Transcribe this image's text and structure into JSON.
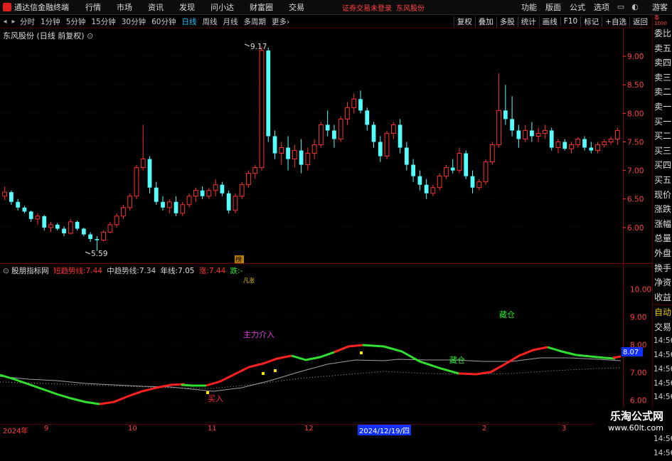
{
  "menubar": {
    "app_title": "通达信金融终端",
    "items": [
      "行情",
      "市场",
      "资讯",
      "发现",
      "问小达",
      "财富圈",
      "交易"
    ],
    "alert": "证券交易未登录",
    "stock": "东风股份",
    "right_items": [
      "功能",
      "版面",
      "公式",
      "选项"
    ],
    "user": "游客"
  },
  "toolbar": {
    "periods": [
      "分时",
      "1分钟",
      "5分钟",
      "15分钟",
      "30分钟",
      "60分钟",
      "日线",
      "周线",
      "月线",
      "多周期",
      "更多"
    ],
    "active_period": "日线",
    "right_buttons": [
      "复权",
      "叠加",
      "多股",
      "统计",
      "画线",
      "F10",
      "标记",
      "+自选",
      "返回"
    ]
  },
  "stock_title": "东风股份 (日线 前复权)",
  "main_chart": {
    "price_max_label": "9.17",
    "price_min_label": "5.59",
    "badge": "榜",
    "y_ticks": [
      "9.00",
      "8.50",
      "8.00",
      "7.50",
      "7.00",
      "6.50",
      "6.00"
    ]
  },
  "indicator": {
    "name": "股朋指标网",
    "short_label": "短趋势线:",
    "short_value": "7.44",
    "mid_label": "中趋势线:",
    "mid_value": "7.34",
    "year_label": "年线:",
    "year_value": "7.05",
    "rise_label": "涨:",
    "rise_value": "7.44",
    "fall_label": "跌:",
    "fall_value": "-",
    "top_mark": "凡涨",
    "annotations": {
      "main_in": "主力介入",
      "hide1": "藏仓",
      "hide2": "藏仓",
      "buy": "买入"
    },
    "y_ticks": [
      "10.00",
      "9.00",
      "8.00",
      "7.00",
      "6.00"
    ],
    "current_value": "8.07"
  },
  "side_panel": {
    "top_labels": [
      "委",
      "1000"
    ],
    "items": [
      "委比",
      "卖五",
      "卖四",
      "卖三",
      "卖二",
      "卖一",
      "买一",
      "买二",
      "买三",
      "买四",
      "买五",
      "现价",
      "涨跌",
      "涨幅",
      "总量",
      "外盘",
      "换手",
      "净资",
      "收益"
    ],
    "items2": [
      "自动",
      "交易"
    ],
    "times": [
      "14:56",
      "14:56",
      "14:56",
      "14:56",
      "14:56",
      "14:56",
      "14:56",
      "14:56",
      "14:56"
    ]
  },
  "x_axis": [
    "2024年",
    "9",
    "10",
    "11",
    "12",
    "2024/12/19/四",
    "2",
    "3"
  ],
  "watermark": {
    "line1": "乐淘公式网",
    "line2": "www.60lt.com"
  },
  "colors": {
    "up": "#ff3030",
    "down": "#54ffff",
    "bg": "#000000",
    "accent_red": "#ff4040",
    "line_green": "#30e030",
    "line_gray": "#a0a0a0"
  },
  "chart_data": {
    "type": "candlestick",
    "price_axis": {
      "min": 5.5,
      "max": 9.3
    },
    "candles": [
      [
        6.55,
        6.72,
        6.48,
        6.62
      ],
      [
        6.62,
        6.65,
        6.4,
        6.45
      ],
      [
        6.45,
        6.5,
        6.3,
        6.35
      ],
      [
        6.35,
        6.38,
        6.25,
        6.28
      ],
      [
        6.28,
        6.3,
        6.1,
        6.15
      ],
      [
        6.15,
        6.25,
        6.05,
        6.2
      ],
      [
        6.2,
        6.22,
        5.95,
        6.0
      ],
      [
        6.0,
        6.1,
        5.92,
        6.05
      ],
      [
        6.05,
        6.08,
        5.95,
        5.98
      ],
      [
        5.98,
        6.02,
        5.85,
        5.9
      ],
      [
        5.9,
        6.15,
        5.88,
        6.1
      ],
      [
        6.1,
        6.12,
        5.95,
        5.98
      ],
      [
        5.98,
        6.0,
        5.85,
        5.88
      ],
      [
        5.88,
        5.92,
        5.75,
        5.8
      ],
      [
        5.8,
        5.85,
        5.59,
        5.78
      ],
      [
        5.78,
        5.95,
        5.76,
        5.92
      ],
      [
        5.92,
        6.1,
        5.9,
        6.05
      ],
      [
        6.05,
        6.25,
        6.0,
        6.2
      ],
      [
        6.2,
        6.4,
        6.15,
        6.35
      ],
      [
        6.35,
        6.6,
        6.3,
        6.55
      ],
      [
        6.55,
        7.1,
        6.5,
        7.05
      ],
      [
        7.05,
        7.8,
        7.0,
        7.2
      ],
      [
        7.2,
        7.25,
        6.6,
        6.7
      ],
      [
        6.7,
        6.8,
        6.4,
        6.45
      ],
      [
        6.45,
        6.55,
        6.3,
        6.35
      ],
      [
        6.35,
        6.5,
        6.25,
        6.45
      ],
      [
        6.45,
        6.55,
        6.2,
        6.25
      ],
      [
        6.25,
        6.45,
        6.2,
        6.4
      ],
      [
        6.4,
        6.6,
        6.35,
        6.55
      ],
      [
        6.55,
        6.7,
        6.45,
        6.65
      ],
      [
        6.65,
        6.72,
        6.5,
        6.55
      ],
      [
        6.55,
        6.7,
        6.5,
        6.65
      ],
      [
        6.65,
        6.85,
        6.55,
        6.75
      ],
      [
        6.75,
        6.8,
        6.55,
        6.6
      ],
      [
        6.6,
        6.65,
        6.25,
        6.3
      ],
      [
        6.3,
        6.6,
        6.25,
        6.55
      ],
      [
        6.55,
        6.8,
        6.5,
        6.75
      ],
      [
        6.75,
        7.0,
        6.7,
        6.95
      ],
      [
        6.95,
        7.1,
        6.85,
        7.05
      ],
      [
        7.05,
        9.17,
        7.0,
        9.1
      ],
      [
        9.1,
        9.15,
        7.5,
        7.6
      ],
      [
        7.6,
        7.7,
        7.2,
        7.3
      ],
      [
        7.3,
        7.5,
        7.1,
        7.4
      ],
      [
        7.4,
        7.6,
        7.0,
        7.2
      ],
      [
        7.2,
        7.45,
        7.05,
        7.35
      ],
      [
        7.35,
        7.55,
        6.95,
        7.1
      ],
      [
        7.1,
        7.4,
        7.0,
        7.3
      ],
      [
        7.3,
        7.55,
        7.2,
        7.45
      ],
      [
        7.45,
        7.85,
        7.4,
        7.8
      ],
      [
        7.8,
        8.05,
        7.6,
        7.7
      ],
      [
        7.7,
        7.8,
        7.4,
        7.55
      ],
      [
        7.55,
        7.95,
        7.5,
        7.9
      ],
      [
        7.9,
        8.2,
        7.8,
        8.1
      ],
      [
        8.1,
        8.35,
        8.0,
        8.25
      ],
      [
        8.25,
        8.4,
        8.0,
        8.05
      ],
      [
        8.05,
        8.1,
        7.7,
        7.8
      ],
      [
        7.8,
        7.85,
        7.4,
        7.5
      ],
      [
        7.5,
        7.6,
        7.15,
        7.25
      ],
      [
        7.25,
        7.7,
        7.2,
        7.65
      ],
      [
        7.65,
        7.85,
        7.55,
        7.8
      ],
      [
        7.8,
        7.9,
        7.3,
        7.4
      ],
      [
        7.4,
        7.5,
        7.0,
        7.1
      ],
      [
        7.1,
        7.2,
        6.8,
        6.9
      ],
      [
        6.9,
        7.0,
        6.65,
        6.75
      ],
      [
        6.75,
        6.85,
        6.5,
        6.6
      ],
      [
        6.6,
        6.75,
        6.55,
        6.7
      ],
      [
        6.7,
        6.95,
        6.65,
        6.9
      ],
      [
        6.9,
        7.1,
        6.85,
        7.05
      ],
      [
        7.05,
        7.2,
        6.95,
        7.0
      ],
      [
        7.0,
        7.4,
        6.95,
        7.3
      ],
      [
        7.3,
        7.35,
        6.85,
        6.9
      ],
      [
        6.9,
        7.0,
        6.6,
        6.7
      ],
      [
        6.7,
        6.85,
        6.65,
        6.8
      ],
      [
        6.8,
        7.2,
        6.75,
        7.15
      ],
      [
        7.15,
        7.5,
        7.1,
        7.45
      ],
      [
        7.45,
        8.7,
        7.4,
        8.05
      ],
      [
        8.05,
        8.5,
        7.8,
        7.9
      ],
      [
        7.9,
        8.3,
        7.6,
        7.7
      ],
      [
        7.7,
        7.8,
        7.4,
        7.55
      ],
      [
        7.55,
        7.8,
        7.5,
        7.7
      ],
      [
        7.7,
        7.85,
        7.5,
        7.6
      ],
      [
        7.6,
        7.75,
        7.5,
        7.65
      ],
      [
        7.65,
        7.8,
        7.55,
        7.7
      ],
      [
        7.7,
        7.75,
        7.35,
        7.4
      ],
      [
        7.4,
        7.55,
        7.3,
        7.5
      ],
      [
        7.5,
        7.55,
        7.35,
        7.38
      ],
      [
        7.38,
        7.5,
        7.3,
        7.45
      ],
      [
        7.45,
        7.58,
        7.4,
        7.55
      ],
      [
        7.55,
        7.6,
        7.35,
        7.4
      ],
      [
        7.4,
        7.5,
        7.3,
        7.35
      ],
      [
        7.35,
        7.5,
        7.3,
        7.45
      ],
      [
        7.45,
        7.55,
        7.4,
        7.5
      ],
      [
        7.5,
        7.6,
        7.45,
        7.55
      ],
      [
        7.55,
        7.75,
        7.45,
        7.7
      ]
    ]
  }
}
